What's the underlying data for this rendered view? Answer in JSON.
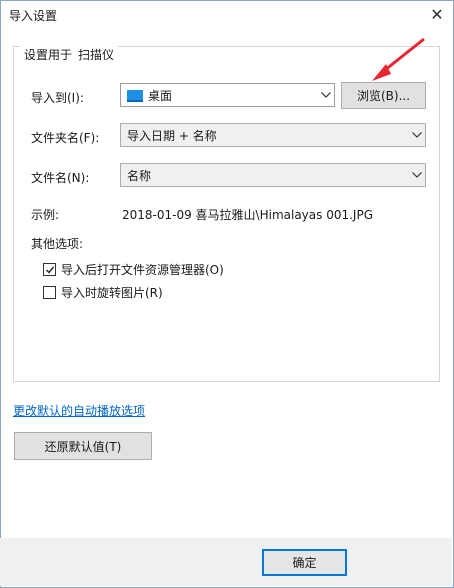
{
  "window": {
    "title": "导入设置"
  },
  "group": {
    "legend_prefix": "设置用于",
    "legend_target": "扫描仪"
  },
  "import_to": {
    "label": "导入到(I):",
    "value": "桌面",
    "browse_label": "浏览(B)..."
  },
  "folder_name": {
    "label": "文件夹名(F):",
    "value": "导入日期 + 名称"
  },
  "file_name": {
    "label": "文件名(N):",
    "value": "名称"
  },
  "example": {
    "label": "示例:",
    "value": "2018-01-09 喜马拉雅山\\Himalayas 001.JPG"
  },
  "other_options": {
    "label": "其他选项:",
    "open_explorer": {
      "label": "导入后打开文件资源管理器(O)",
      "checked": true
    },
    "rotate": {
      "label": "导入时旋转图片(R)",
      "checked": false
    }
  },
  "link_autoplay": "更改默认的自动播放选项",
  "restore_defaults": "还原默认值(T)",
  "ok": "确定",
  "colors": {
    "accent": "#0078d7",
    "link": "#0066cc",
    "annotation": "#e8262f"
  }
}
